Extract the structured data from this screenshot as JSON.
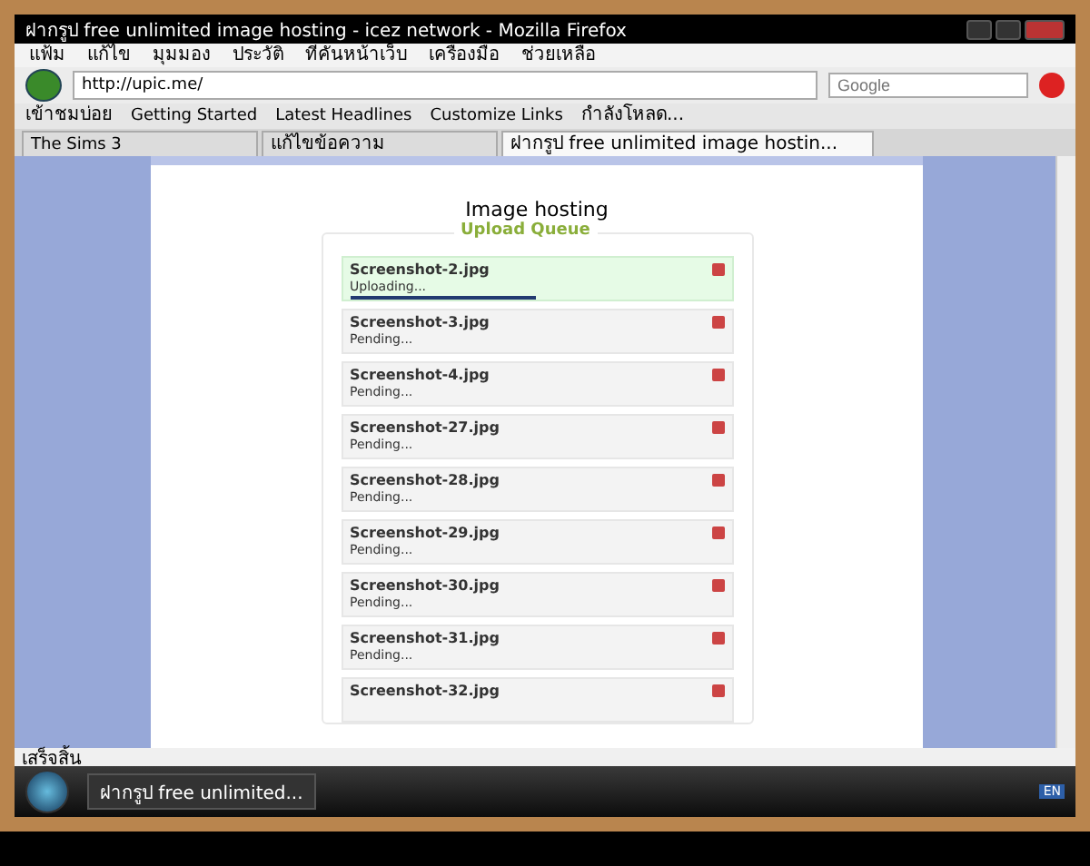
{
  "window": {
    "title": "ฝากรูป free unlimited image hosting - icez network - Mozilla Firefox"
  },
  "menu": [
    "แฟ้ม",
    "แก้ไข",
    "มุมมอง",
    "ประวัติ",
    "ที่คั่นหน้าเว็บ",
    "เครื่องมือ",
    "ช่วยเหลือ"
  ],
  "address": {
    "value": "http://upic.me/"
  },
  "search": {
    "placeholder": "Google"
  },
  "bookmarks": [
    "เข้าชมบ่อย",
    "Getting Started",
    "Latest Headlines",
    "Customize Links",
    "กำลังโหลด..."
  ],
  "tabs": [
    {
      "label": "The Sims 3",
      "selected": false
    },
    {
      "label": "แก้ไขข้อความ",
      "selected": false
    },
    {
      "label": "ฝากรูป free unlimited image hostin...",
      "selected": true
    }
  ],
  "page": {
    "heading": "Image hosting",
    "queue_title": "Upload Queue"
  },
  "queue": [
    {
      "name": "Screenshot-2.jpg",
      "status": "Uploading...",
      "kind": "uploading",
      "level": 0.48
    },
    {
      "name": "Screenshot-3.jpg",
      "status": "Pending...",
      "kind": "pending"
    },
    {
      "name": "Screenshot-4.jpg",
      "status": "Pending...",
      "kind": "pending"
    },
    {
      "name": "Screenshot-27.jpg",
      "status": "Pending...",
      "kind": "pending"
    },
    {
      "name": "Screenshot-28.jpg",
      "status": "Pending...",
      "kind": "pending"
    },
    {
      "name": "Screenshot-29.jpg",
      "status": "Pending...",
      "kind": "pending"
    },
    {
      "name": "Screenshot-30.jpg",
      "status": "Pending...",
      "kind": "pending"
    },
    {
      "name": "Screenshot-31.jpg",
      "status": "Pending...",
      "kind": "pending"
    },
    {
      "name": "Screenshot-32.jpg",
      "kind": "pending"
    }
  ],
  "status_bar": "เสร็จสิ้น",
  "taskbar": {
    "window": "ฝากรูป free unlimited...",
    "language": "EN"
  }
}
